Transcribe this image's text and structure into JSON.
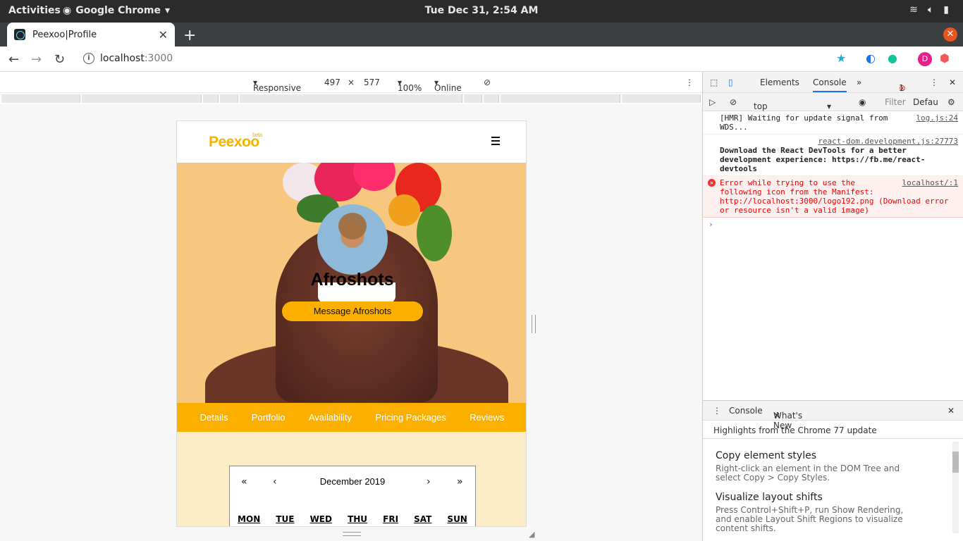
{
  "system": {
    "activities": "Activities",
    "app": "Google Chrome",
    "clock": "Tue Dec 31,  2:54 AM"
  },
  "browser": {
    "tab_title": "Peexoo|Profile",
    "url_host": "localhost",
    "url_port": ":3000",
    "extension_initial": "D"
  },
  "device_toolbar": {
    "mode": "Responsive",
    "width": "497",
    "x": "×",
    "height": "577",
    "zoom": "100%",
    "network": "Online"
  },
  "page": {
    "logo": "Peexoo",
    "logo_badge": "beta",
    "profile_name": "Afroshots",
    "message_button": "Message Afroshots",
    "tabs": [
      "Details",
      "Portfolio",
      "Availability",
      "Pricing Packages",
      "Reviews"
    ],
    "calendar": {
      "prev_year": "«",
      "prev_month": "‹",
      "month": "December 2019",
      "next_month": "›",
      "next_year": "»",
      "days": [
        "MON",
        "TUE",
        "WED",
        "THU",
        "FRI",
        "SAT",
        "SUN"
      ]
    }
  },
  "devtools": {
    "tabs": [
      "Elements",
      "Console"
    ],
    "error_count": "1",
    "context": "top",
    "filter_placeholder": "Filter",
    "levels": "Defau",
    "messages": [
      {
        "text": "[HMR] Waiting for update signal from WDS...",
        "src": "log.js:24",
        "type": "log"
      },
      {
        "text": "Download the React DevTools for a better development experience: https://fb.me/react-devtools",
        "src": "react-dom.development.js:27773",
        "type": "log"
      },
      {
        "text": "Error while trying to use the following icon from the Manifest: http://localhost:3000/logo192.png (Download error or resource isn't a valid image)",
        "src": "localhost/:1",
        "type": "error"
      }
    ],
    "drawer_tabs": [
      "Console",
      "What's New"
    ],
    "drawer_header": "Highlights from the Chrome 77 update",
    "features": [
      {
        "title": "Copy element styles",
        "desc": "Right-click an element in the DOM Tree and select Copy > Copy Styles."
      },
      {
        "title": "Visualize layout shifts",
        "desc": "Press Control+Shift+P, run Show Rendering, and enable Layout Shift Regions to visualize content shifts."
      }
    ]
  },
  "colors": {
    "brand": "#fbb000",
    "hero_bg": "#f7c77f",
    "calendar_bg": "#fdedc7",
    "error": "#e33"
  }
}
